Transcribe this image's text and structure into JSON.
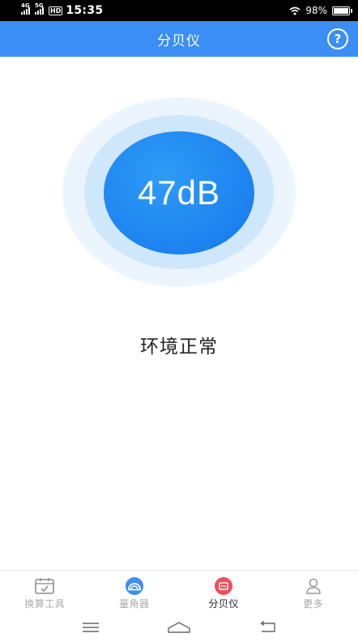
{
  "status_bar": {
    "net1": "4G",
    "net2": "5G",
    "hd": "HD",
    "time": "15:35",
    "battery_text": "98%",
    "battery_level": 0.98
  },
  "header": {
    "title": "分贝仪",
    "help_label": "?"
  },
  "meter": {
    "reading": "47dB",
    "status": "环境正常",
    "colors": {
      "inner": "#1c82ef",
      "mid": "#cfe7fb",
      "outer": "#e3f1fd"
    }
  },
  "tabs": [
    {
      "label": "换算工具",
      "icon": "calendar-check-icon",
      "active": false
    },
    {
      "label": "量角器",
      "icon": "protractor-icon",
      "active": false,
      "color": "#3a8ef6"
    },
    {
      "label": "分贝仪",
      "icon": "decibel-meter-icon",
      "active": true,
      "color": "#f04d5a"
    },
    {
      "label": "更多",
      "icon": "user-icon",
      "active": false
    }
  ],
  "system_nav": [
    "menu-icon",
    "home-icon",
    "back-icon"
  ],
  "colors": {
    "brand": "#3a8ef6",
    "active_tab_text": "#222222",
    "inactive_tab_text": "#a9a9a9"
  }
}
